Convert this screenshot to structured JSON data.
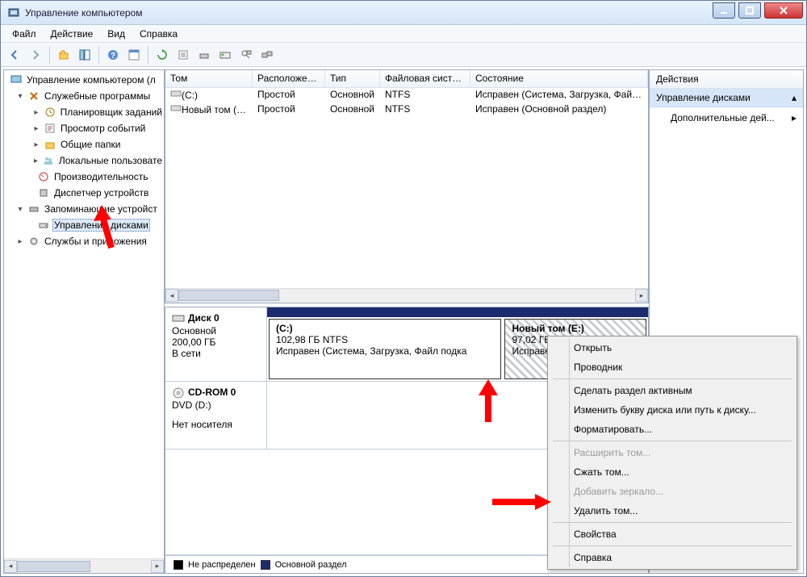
{
  "window": {
    "title": "Управление компьютером"
  },
  "menu": {
    "file": "Файл",
    "action": "Действие",
    "view": "Вид",
    "help": "Справка"
  },
  "tree": {
    "root": "Управление компьютером (л",
    "group_utils": "Служебные программы",
    "scheduler": "Планировщик заданий",
    "eventviewer": "Просмотр событий",
    "shared": "Общие папки",
    "localusers": "Локальные пользовате",
    "perf": "Производительность",
    "devmgr": "Диспетчер устройств",
    "group_storage": "Запоминающие устройст",
    "diskmgmt": "Управление дисками",
    "group_services": "Службы и приложения"
  },
  "list": {
    "headers": {
      "vol": "Том",
      "layout": "Расположение",
      "type": "Тип",
      "fs": "Файловая система",
      "status": "Состояние"
    },
    "rows": [
      {
        "vol": "(C:)",
        "layout": "Простой",
        "type": "Основной",
        "fs": "NTFS",
        "status": "Исправен (Система, Загрузка, Файл п"
      },
      {
        "vol": "Новый том (E:)",
        "layout": "Простой",
        "type": "Основной",
        "fs": "NTFS",
        "status": "Исправен (Основной раздел)"
      }
    ]
  },
  "disks": {
    "d0": {
      "name": "Диск 0",
      "type": "Основной",
      "size": "200,00 ГБ",
      "state": "В сети"
    },
    "d0p1": {
      "title": "(C:)",
      "line2": "102,98 ГБ NTFS",
      "line3": "Исправен (Система, Загрузка, Файл подка"
    },
    "d0p2": {
      "title": "Новый том  (E:)",
      "line2": "97,02 ГБ NTFS",
      "line3": "Исправен (Основной "
    },
    "cd": {
      "name": "CD-ROM 0",
      "type": "DVD (D:)",
      "state": "Нет носителя"
    }
  },
  "legend": {
    "unalloc": "Не распределен",
    "primary": "Основной раздел"
  },
  "actions": {
    "title": "Действия",
    "section": "Управление дисками",
    "more": "Дополнительные дей..."
  },
  "ctx": {
    "open": "Открыть",
    "explorer": "Проводник",
    "active": "Сделать раздел активным",
    "letter": "Изменить букву диска или путь к диску...",
    "format": "Форматировать...",
    "extend": "Расширить том...",
    "shrink": "Сжать том...",
    "mirror": "Добавить зеркало...",
    "delete": "Удалить том...",
    "props": "Свойства",
    "help": "Справка"
  }
}
